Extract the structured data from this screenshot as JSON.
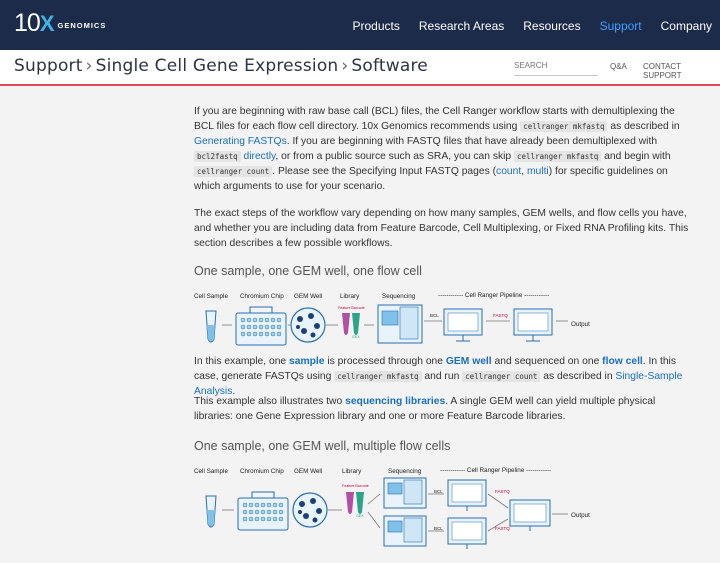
{
  "brand": {
    "number": "10",
    "x": "X",
    "name": "GENOMICS"
  },
  "nav": {
    "items": [
      "Products",
      "Research Areas",
      "Resources",
      "Support",
      "Company"
    ],
    "active": "Support"
  },
  "breadcrumb": {
    "items": [
      "Support",
      "Single Cell Gene Expression",
      "Software"
    ],
    "separator": "›"
  },
  "search": {
    "placeholder": "SEARCH"
  },
  "subnav": {
    "qa": "Q&A",
    "contact": "CONTACT SUPPORT"
  },
  "content": {
    "p1": {
      "t1": "If you are beginning with raw base call (BCL) files, the Cell Ranger workflow starts with demultiplexing the BCL files for each flow cell directory. 10x Genomics recommends using ",
      "c1": "cellranger mkfastq",
      "t2": " as described in ",
      "l1": "Generating FASTQs",
      "t3": ". If you are beginning with FASTQ files that have already been demultiplexed with ",
      "c2": "bcl2fastq",
      "t4": " ",
      "l2": "directly",
      "t5": ", or from a public source such as SRA, you can skip ",
      "c3": "cellranger mkfastq",
      "t6": " and begin with ",
      "c4": "cellranger count",
      "t7": ". Please see the Specifying Input FASTQ pages (",
      "l3": "count",
      "t8": ", ",
      "l4": "multi",
      "t9": ") for specific guidelines on which arguments to use for your scenario."
    },
    "p2": "The exact steps of the workflow vary depending on how many samples, GEM wells, and flow cells you have, and whether you are including data from Feature Barcode, Cell Multiplexing, or Fixed RNA Profiling kits. This section describes a few possible workflows.",
    "h1": "One sample, one GEM well, one flow cell",
    "p3": {
      "t1": "In this example, one ",
      "l1": "sample",
      "t2": " is processed through one ",
      "l2": "GEM well",
      "t3": " and sequenced on one ",
      "l3": "flow cell",
      "t4": ". In this case, generate FASTQs using ",
      "c1": "cellranger mkfastq",
      "t5": " and run ",
      "c2": "cellranger count",
      "t6": " as described in ",
      "l4": "Single-Sample Analysis",
      "t7": "."
    },
    "p4": {
      "t1": "This example also illustrates two ",
      "l1": "sequencing libraries",
      "t2": ". A single GEM well can yield multiple physical libraries: one Gene Expression library and one or more Feature Barcode libraries."
    },
    "h2": "One sample, one GEM well, multiple flow cells"
  },
  "diagram1": {
    "labels": {
      "cell_sample": "Cell Sample",
      "chromium_chip": "Chromium Chip",
      "gem_well": "GEM Well",
      "library": "Library",
      "sequencing": "Sequencing",
      "pipeline": "------------ Cell Ranger Pipeline ------------",
      "bcl": "BCL",
      "fastq": "FASTQ",
      "mkfastq": "mkfastq",
      "count": "count",
      "output": "Output",
      "feature_barcode": "Feature Barcode",
      "gex": "GEX"
    }
  },
  "diagram2": {
    "labels": {
      "cell_sample": "Cell Sample",
      "chromium_chip": "Chromium Chip",
      "gem_well": "GEM Well",
      "library": "Library",
      "sequencing": "Sequencing",
      "pipeline": "------------ Cell Ranger Pipeline ------------",
      "bcl": "BCL",
      "fastq": "FASTQ",
      "mkfastq": "mkfastq",
      "count": "count",
      "output": "Output",
      "feature_barcode": "Feature Barcode",
      "gex": "GEX"
    }
  },
  "colors": {
    "topnav": "#1c2b4a",
    "accent": "#3cb4e5",
    "link": "#1a6fc2",
    "divider": "#e0465a",
    "content_bg": "#f3f3f3"
  }
}
